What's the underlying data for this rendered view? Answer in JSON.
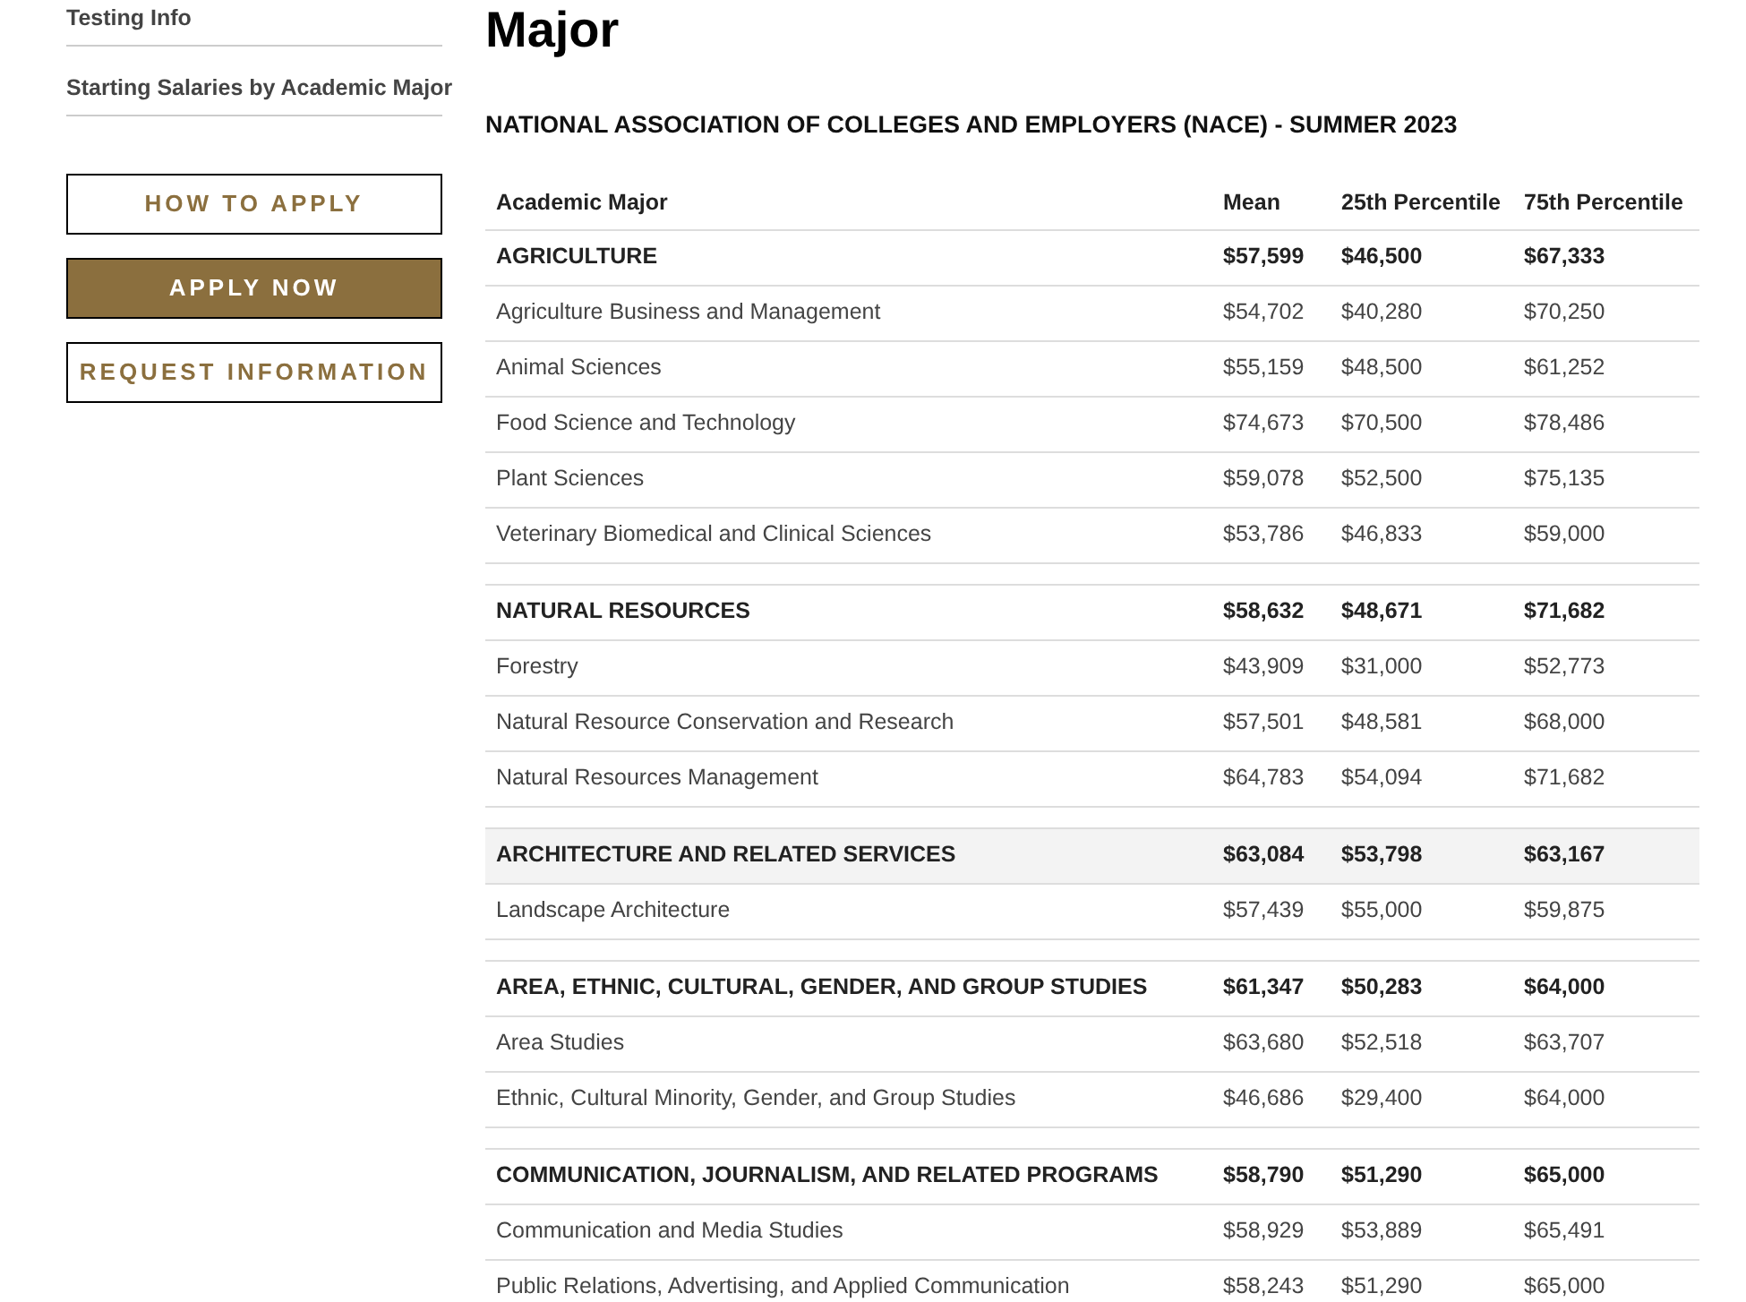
{
  "sidebar": {
    "links": [
      "Testing Info",
      "Starting Salaries by Academic Major"
    ],
    "buttons": [
      {
        "label": "HOW TO APPLY",
        "kind": "outline"
      },
      {
        "label": "APPLY NOW",
        "kind": "filled"
      },
      {
        "label": "REQUEST INFORMATION",
        "kind": "outline"
      }
    ]
  },
  "page_title": "Major",
  "subtitle": "NATIONAL ASSOCIATION OF COLLEGES AND EMPLOYERS (NACE) - SUMMER 2023",
  "table": {
    "columns": [
      "Academic Major",
      "Mean",
      "25th Percentile",
      "75th Percentile"
    ],
    "groups": [
      {
        "name": "AGRICULTURE",
        "mean": "$57,599",
        "p25": "$46,500",
        "p75": "$67,333",
        "highlighted": false,
        "majors": [
          {
            "name": "Agriculture Business and Management",
            "mean": "$54,702",
            "p25": "$40,280",
            "p75": "$70,250"
          },
          {
            "name": "Animal Sciences",
            "mean": "$55,159",
            "p25": "$48,500",
            "p75": "$61,252"
          },
          {
            "name": "Food Science and Technology",
            "mean": "$74,673",
            "p25": "$70,500",
            "p75": "$78,486"
          },
          {
            "name": "Plant Sciences",
            "mean": "$59,078",
            "p25": "$52,500",
            "p75": "$75,135"
          },
          {
            "name": "Veterinary Biomedical and Clinical Sciences",
            "mean": "$53,786",
            "p25": "$46,833",
            "p75": "$59,000"
          }
        ]
      },
      {
        "name": "NATURAL RESOURCES",
        "mean": "$58,632",
        "p25": "$48,671",
        "p75": "$71,682",
        "highlighted": false,
        "majors": [
          {
            "name": "Forestry",
            "mean": "$43,909",
            "p25": "$31,000",
            "p75": "$52,773"
          },
          {
            "name": "Natural Resource Conservation and Research",
            "mean": "$57,501",
            "p25": "$48,581",
            "p75": "$68,000"
          },
          {
            "name": "Natural Resources Management",
            "mean": "$64,783",
            "p25": "$54,094",
            "p75": "$71,682"
          }
        ]
      },
      {
        "name": "ARCHITECTURE AND RELATED SERVICES",
        "mean": "$63,084",
        "p25": "$53,798",
        "p75": "$63,167",
        "highlighted": true,
        "majors": [
          {
            "name": "Landscape Architecture",
            "mean": "$57,439",
            "p25": "$55,000",
            "p75": "$59,875"
          }
        ]
      },
      {
        "name": "AREA, ETHNIC, CULTURAL, GENDER, AND GROUP STUDIES",
        "mean": "$61,347",
        "p25": "$50,283",
        "p75": "$64,000",
        "highlighted": false,
        "majors": [
          {
            "name": "Area Studies",
            "mean": "$63,680",
            "p25": "$52,518",
            "p75": "$63,707"
          },
          {
            "name": "Ethnic, Cultural Minority, Gender, and Group Studies",
            "mean": "$46,686",
            "p25": "$29,400",
            "p75": "$64,000"
          }
        ]
      },
      {
        "name": "COMMUNICATION, JOURNALISM, AND RELATED PROGRAMS",
        "mean": "$58,790",
        "p25": "$51,290",
        "p75": "$65,000",
        "highlighted": false,
        "majors": [
          {
            "name": "Communication and Media Studies",
            "mean": "$58,929",
            "p25": "$53,889",
            "p75": "$65,491"
          },
          {
            "name": "Public Relations, Advertising, and Applied Communication",
            "mean": "$58,243",
            "p25": "$51,290",
            "p75": "$65,000"
          }
        ]
      }
    ]
  }
}
